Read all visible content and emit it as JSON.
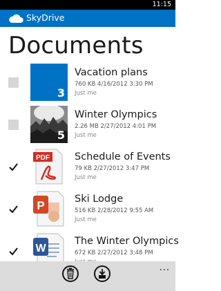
{
  "status": {
    "time": "11:15"
  },
  "app": {
    "title": "SkyDrive"
  },
  "page": {
    "title": "Documents"
  },
  "items": [
    {
      "name": "Vacation plans",
      "meta": "760 KB  4/16/2012 3:30 PM",
      "owner": "Just me",
      "checked": false,
      "type": "folder",
      "count": "3",
      "icon": "folder-icon"
    },
    {
      "name": "Winter Olympics",
      "meta": "2.26 MB  2/27/2012 4:01 PM",
      "owner": "Just me",
      "checked": false,
      "type": "photo-folder",
      "count": "5",
      "icon": "photo-folder-icon"
    },
    {
      "name": "Schedule of Events",
      "meta": "79 KB  2/27/2012 3:47 PM",
      "owner": "Just me",
      "checked": true,
      "type": "pdf",
      "icon": "pdf-icon",
      "icon_label": "PDF"
    },
    {
      "name": "Ski Lodge",
      "meta": "516 KB  2/28/2012 9:55 AM",
      "owner": "Just me",
      "checked": true,
      "type": "powerpoint",
      "icon": "powerpoint-icon",
      "icon_label": "P"
    },
    {
      "name": "The Winter Olympics",
      "meta": "672 KB  2/27/2012 3:48 PM",
      "owner": "Just me",
      "checked": true,
      "type": "word",
      "icon": "word-icon",
      "icon_label": "W"
    }
  ],
  "appbar": {
    "more_label": "...",
    "buttons": [
      {
        "icon": "delete-icon"
      },
      {
        "icon": "download-icon"
      }
    ]
  },
  "colors": {
    "accent": "#0072c6",
    "status_bar": "#000000",
    "appbar_bg": "#dcdcdc",
    "pdf_red": "#d82a20",
    "ppt_orange": "#d24726",
    "word_blue": "#2b5797"
  }
}
